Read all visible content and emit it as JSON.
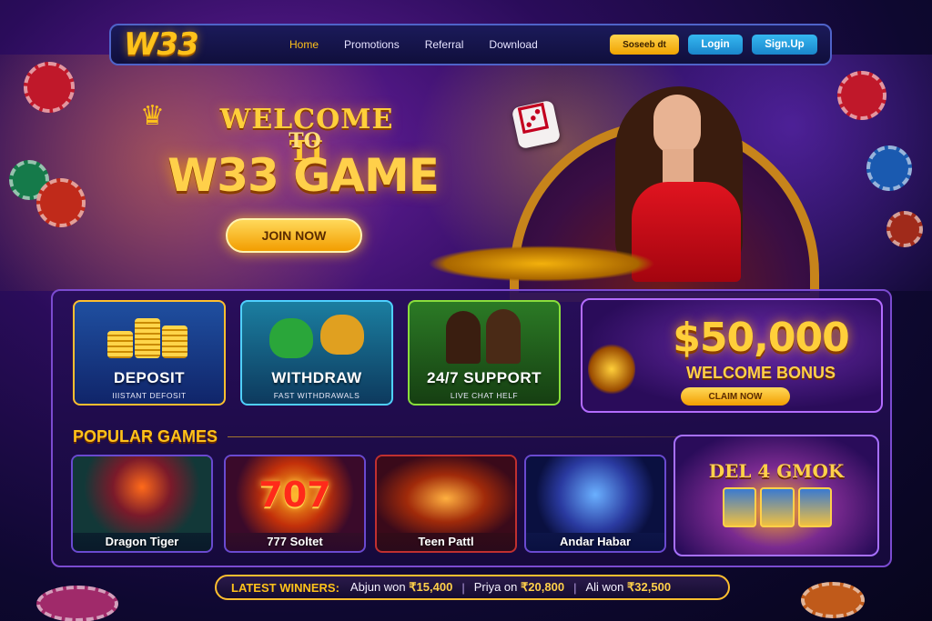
{
  "navbar": {
    "logo": "W33",
    "links": [
      "Home",
      "Promotions",
      "Referral",
      "Download"
    ],
    "active_link": "Home",
    "select_label": "Soseeb dt",
    "login_label": "Login",
    "signup_label": "Sign.Up"
  },
  "hero": {
    "welcome_line": "WELCOME TI",
    "to_line": "TO",
    "game_line": "W33 GAME",
    "join_label": "JOIN NOW"
  },
  "features": [
    {
      "title": "DEPOSIT",
      "subtitle": "IIISTANT DEFOSIT"
    },
    {
      "title": "WITHDRAW",
      "subtitle": "FAST WITHDRAWALS"
    },
    {
      "title": "24/7 SUPPORT",
      "subtitle": "LIVE CHAT HELF"
    }
  ],
  "bonus": {
    "amount": "$50,000",
    "label": "WELCOME BONUS",
    "claim_label": "CLAIM NOW"
  },
  "popular": {
    "title": "POPULAR GAMES",
    "games": [
      {
        "name": "Dragon Tiger"
      },
      {
        "name": "777 Soltet",
        "art_text": "707"
      },
      {
        "name": "Teen Pattl"
      },
      {
        "name": "Andar Habar"
      }
    ],
    "featured_slot_title": "DEL 4 GMOK"
  },
  "winners": {
    "label": "LATEST WINNERS:",
    "entries": [
      {
        "text": "Abjun won",
        "amount": "₹15,400"
      },
      {
        "text": "Priya on",
        "amount": "₹20,800"
      },
      {
        "text": "Ali won",
        "amount": "₹32,500"
      }
    ],
    "separator": "|"
  },
  "colors": {
    "accent_gold": "#ffc21a",
    "login_blue": "#1a86cc",
    "background_purple": "#2a0c5a"
  }
}
